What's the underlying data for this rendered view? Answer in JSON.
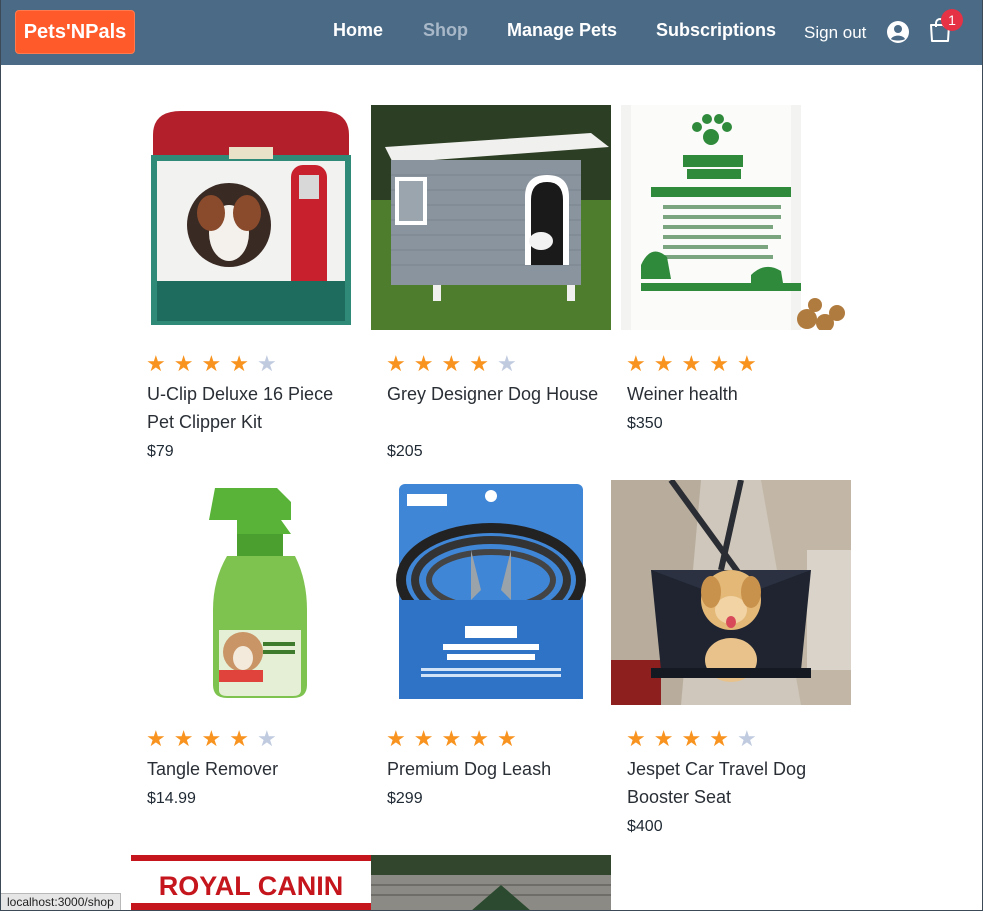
{
  "header": {
    "logo": "Pets'NPals",
    "nav": [
      {
        "label": "Home",
        "active": false
      },
      {
        "label": "Shop",
        "active": true
      },
      {
        "label": "Manage Pets",
        "active": false
      },
      {
        "label": "Subscriptions",
        "active": false
      }
    ],
    "sign_out": "Sign out",
    "cart_count": "1",
    "icons": {
      "user": "user-circle-icon",
      "cart": "shopping-bag-icon"
    }
  },
  "products": [
    {
      "name": "U-Clip Deluxe 16 Piece Pet Clipper Kit",
      "price": "$79",
      "rating": 4,
      "image": "clipper-kit-image"
    },
    {
      "name": "Grey Designer Dog House",
      "price": "$205",
      "rating": 4,
      "image": "dog-house-image"
    },
    {
      "name": "Weiner health",
      "price": "$350",
      "rating": 5,
      "image": "supplement-jar-image"
    },
    {
      "name": "Tangle Remover",
      "price": "$14.99",
      "rating": 4,
      "image": "spray-bottle-image"
    },
    {
      "name": "Premium Dog Leash",
      "price": "$299",
      "rating": 5,
      "image": "tie-out-cable-image"
    },
    {
      "name": "Jespet Car Travel Dog Booster Seat",
      "price": "$400",
      "rating": 4,
      "image": "car-seat-image"
    }
  ],
  "partial_products": [
    {
      "image_text": "ROYAL CANIN"
    },
    {
      "image_text": ""
    }
  ],
  "status_bar": "localhost:3000/shop",
  "colors": {
    "navbar": "#4a6a86",
    "logo": "#ff5a2a",
    "star_on": "#f7931e",
    "star_off": "#c0cbe0",
    "badge": "#e53245"
  }
}
